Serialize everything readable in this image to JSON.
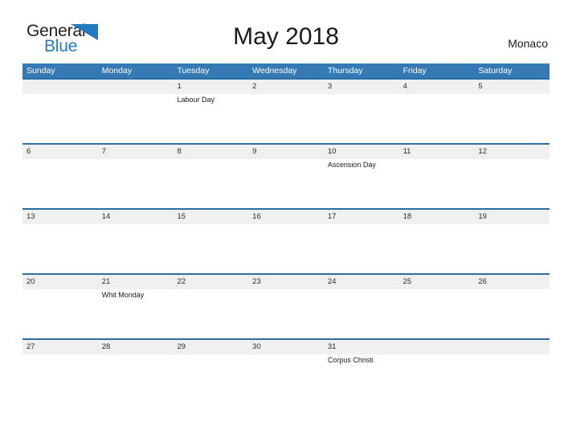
{
  "brand": {
    "name_part1": "General",
    "name_part2": "Blue",
    "accent_color": "#1f7ac0",
    "flag_icon": "triangle-flag-icon"
  },
  "header": {
    "title": "May 2018",
    "region": "Monaco"
  },
  "calendar": {
    "header_bg": "#3579b5",
    "row_border_color": "#2e6da4",
    "date_band_color": "#f0f0f0",
    "weekdays": [
      "Sunday",
      "Monday",
      "Tuesday",
      "Wednesday",
      "Thursday",
      "Friday",
      "Saturday"
    ],
    "weeks": [
      [
        {
          "date": "",
          "event": ""
        },
        {
          "date": "",
          "event": ""
        },
        {
          "date": "1",
          "event": "Labour Day"
        },
        {
          "date": "2",
          "event": ""
        },
        {
          "date": "3",
          "event": ""
        },
        {
          "date": "4",
          "event": ""
        },
        {
          "date": "5",
          "event": ""
        }
      ],
      [
        {
          "date": "6",
          "event": ""
        },
        {
          "date": "7",
          "event": ""
        },
        {
          "date": "8",
          "event": ""
        },
        {
          "date": "9",
          "event": ""
        },
        {
          "date": "10",
          "event": "Ascension Day"
        },
        {
          "date": "11",
          "event": ""
        },
        {
          "date": "12",
          "event": ""
        }
      ],
      [
        {
          "date": "13",
          "event": ""
        },
        {
          "date": "14",
          "event": ""
        },
        {
          "date": "15",
          "event": ""
        },
        {
          "date": "16",
          "event": ""
        },
        {
          "date": "17",
          "event": ""
        },
        {
          "date": "18",
          "event": ""
        },
        {
          "date": "19",
          "event": ""
        }
      ],
      [
        {
          "date": "20",
          "event": ""
        },
        {
          "date": "21",
          "event": "Whit Monday"
        },
        {
          "date": "22",
          "event": ""
        },
        {
          "date": "23",
          "event": ""
        },
        {
          "date": "24",
          "event": ""
        },
        {
          "date": "25",
          "event": ""
        },
        {
          "date": "26",
          "event": ""
        }
      ],
      [
        {
          "date": "27",
          "event": ""
        },
        {
          "date": "28",
          "event": ""
        },
        {
          "date": "29",
          "event": ""
        },
        {
          "date": "30",
          "event": ""
        },
        {
          "date": "31",
          "event": "Corpus Christi"
        },
        {
          "date": "",
          "event": ""
        },
        {
          "date": "",
          "event": ""
        }
      ]
    ]
  }
}
